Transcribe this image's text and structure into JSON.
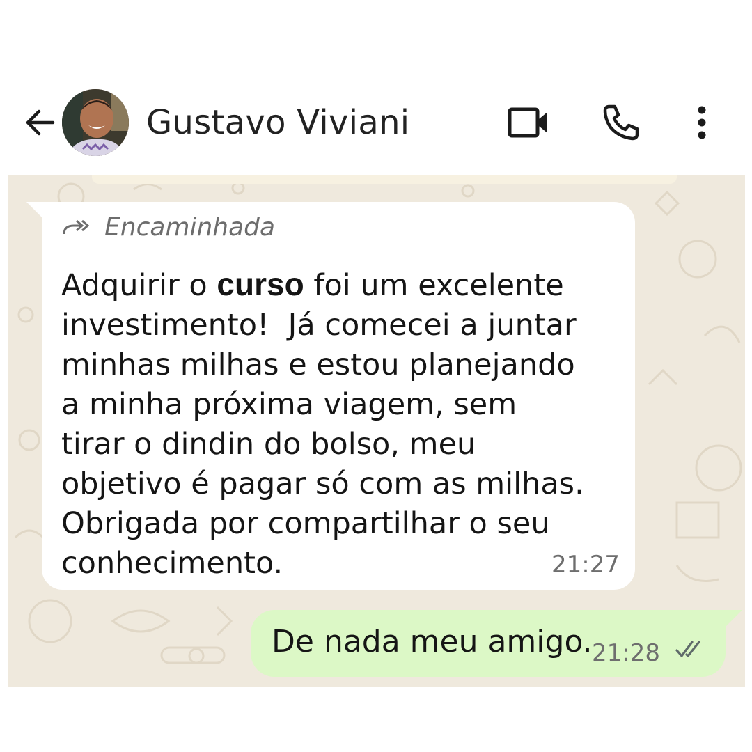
{
  "header": {
    "contact_name": "Gustavo Viviani",
    "icons": [
      "back-arrow-icon",
      "video-call-icon",
      "phone-icon",
      "more-vert-icon"
    ]
  },
  "messages": [
    {
      "direction": "incoming",
      "forwarded_label": "Encaminhada",
      "text_before_bold": "Adquirir o ",
      "text_bold": "curso",
      "text_after_bold": " foi um excelente\ninvestimento!  Já comecei a juntar\nminhas milhas e estou planejando\na minha próxima viagem, sem\ntirar o dindin do bolso, meu\nobjetivo é pagar só com as milhas.\nObrigada por compartilhar o seu\nconhecimento.",
      "time": "21:27"
    },
    {
      "direction": "outgoing",
      "text": "De nada meu amigo.",
      "time": "21:28",
      "status": "read"
    }
  ],
  "colors": {
    "chat_background": "#efe9dd",
    "incoming_bubble": "#ffffff",
    "outgoing_bubble": "#dcf8c6",
    "read_ticks": "#5f6b6a"
  }
}
